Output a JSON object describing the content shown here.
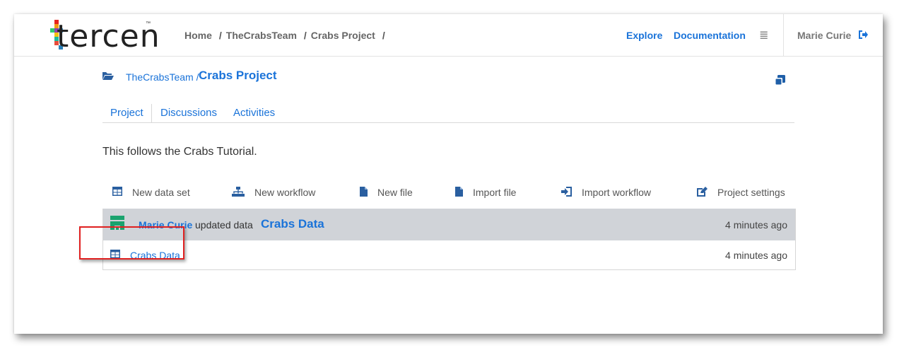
{
  "header": {
    "logo_text": "tercen",
    "logo_tm": "™",
    "breadcrumb": [
      "Home",
      "TheCrabsTeam",
      "Crabs Project"
    ],
    "breadcrumb_sep": "/",
    "nav": {
      "explore": "Explore",
      "documentation": "Documentation"
    },
    "user": "Marie Curie"
  },
  "project": {
    "team": "TheCrabsTeam /",
    "name": "Crabs Project"
  },
  "tabs": [
    "Project",
    "Discussions",
    "Activities"
  ],
  "description": "This follows the Crabs Tutorial.",
  "actions": {
    "new_dataset": "New data set",
    "new_workflow": "New workflow",
    "new_file": "New file",
    "import_file": "Import file",
    "import_workflow": "Import workflow",
    "project_settings": "Project settings"
  },
  "activity": [
    {
      "user": "Marie Curie",
      "verb": "updated data",
      "target": "Crabs Data",
      "time": "4 minutes ago"
    },
    {
      "name": "Crabs Data",
      "time": "4 minutes ago"
    }
  ],
  "colors": {
    "link": "#1a73d9",
    "row_highlight": "#d0d3d8",
    "annotation": "#e02020"
  }
}
